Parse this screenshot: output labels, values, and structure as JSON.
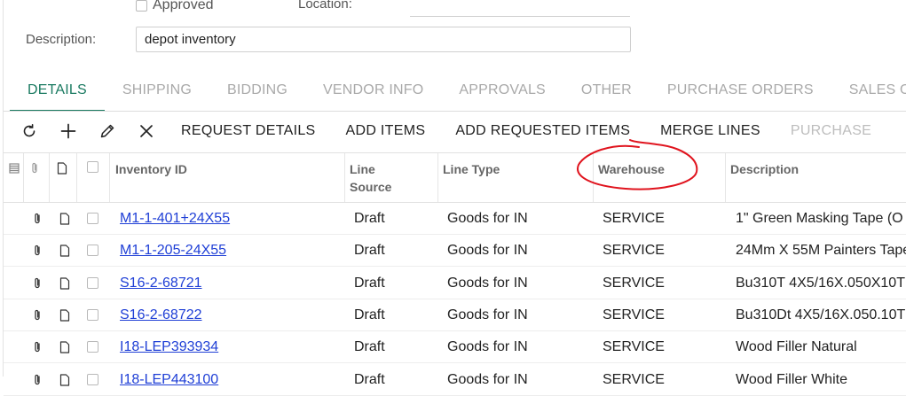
{
  "form": {
    "approved_label": "Approved",
    "location_label": "Location:",
    "description_label": "Description:",
    "description_value": "depot inventory"
  },
  "tabs": [
    {
      "label": "DETAILS",
      "active": true
    },
    {
      "label": "SHIPPING"
    },
    {
      "label": "BIDDING"
    },
    {
      "label": "VENDOR INFO"
    },
    {
      "label": "APPROVALS"
    },
    {
      "label": "OTHER"
    },
    {
      "label": "PURCHASE ORDERS"
    },
    {
      "label": "SALES O"
    }
  ],
  "toolbar": {
    "icons": [
      "refresh-icon",
      "add-icon",
      "edit-icon",
      "delete-icon"
    ],
    "request_details": "REQUEST DETAILS",
    "add_items": "ADD ITEMS",
    "add_requested_items": "ADD REQUESTED ITEMS",
    "merge_lines": "MERGE LINES",
    "purchase": "PURCHASE"
  },
  "grid": {
    "columns": {
      "inventory_id": "Inventory ID",
      "line_source": "Line Source",
      "line_type": "Line Type",
      "warehouse": "Warehouse",
      "description": "Description"
    },
    "rows": [
      {
        "inventory_id": "M1-1-401+24X55",
        "line_source": "Draft",
        "line_type": "Goods for IN",
        "warehouse": "SERVICE",
        "description": "1\" Green Masking Tape (O"
      },
      {
        "inventory_id": "M1-1-205-24X55",
        "line_source": "Draft",
        "line_type": "Goods for IN",
        "warehouse": "SERVICE",
        "description": "24Mm X 55M Painters Tape"
      },
      {
        "inventory_id": "S16-2-68721",
        "line_source": "Draft",
        "line_type": "Goods for IN",
        "warehouse": "SERVICE",
        "description": "Bu310T 4X5/16X.050X10T"
      },
      {
        "inventory_id": "S16-2-68722",
        "line_source": "Draft",
        "line_type": "Goods for IN",
        "warehouse": "SERVICE",
        "description": "Bu310Dt 4X5/16X.050.10T"
      },
      {
        "inventory_id": "I18-LEP393934",
        "line_source": "Draft",
        "line_type": "Goods for IN",
        "warehouse": "SERVICE",
        "description": "Wood Filler Natural"
      },
      {
        "inventory_id": "I18-LEP443100",
        "line_source": "Draft",
        "line_type": "Goods for IN",
        "warehouse": "SERVICE",
        "description": "Wood Filler White"
      }
    ]
  },
  "colors": {
    "accent": "#1a7a61",
    "link": "#1f3fd6",
    "annotation": "#e0141e"
  }
}
